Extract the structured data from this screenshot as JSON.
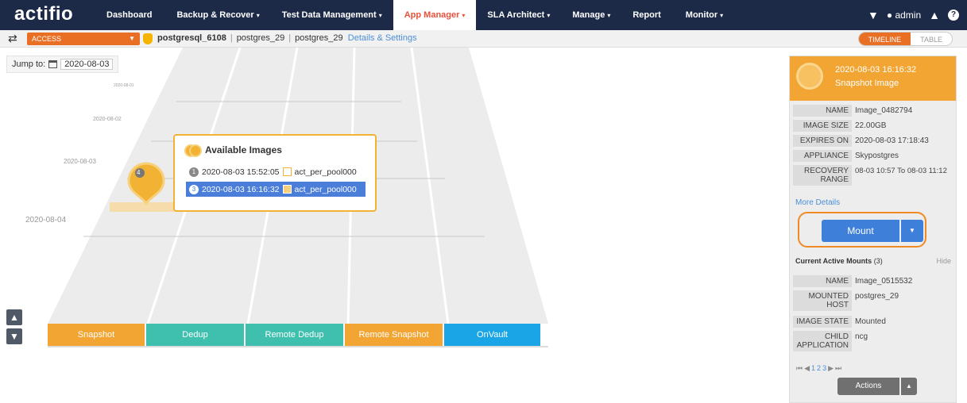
{
  "app": {
    "logo": "actifio"
  },
  "nav": [
    {
      "label": "Dashboard",
      "caret": ""
    },
    {
      "label": "Backup & Recover",
      "caret": "▾"
    },
    {
      "label": "Test Data Management",
      "caret": "▾"
    },
    {
      "label": "App Manager",
      "caret": "▾"
    },
    {
      "label": "SLA Architect",
      "caret": "▾"
    },
    {
      "label": "Manage",
      "caret": "▾"
    },
    {
      "label": "Report",
      "caret": ""
    },
    {
      "label": "Monitor",
      "caret": "▾"
    }
  ],
  "nav_active": "App Manager",
  "user": {
    "name": "admin"
  },
  "subbar": {
    "access_label": "ACCESS",
    "app_name": "postgresql_6108",
    "crumb_2": "postgres_29",
    "crumb_3": "postgres_29",
    "details_link": "Details & Settings",
    "view_timeline": "TIMELINE",
    "view_table": "TABLE"
  },
  "timeline": {
    "jump_label": "Jump to:",
    "jump_date": "2020-08-03",
    "date_labels": [
      "2020-08-01",
      "2020-08-02",
      "2020-08-03",
      "2020-08-04"
    ],
    "marker_count": "4",
    "lanes": [
      {
        "label": "Snapshot",
        "color": "#f2a533"
      },
      {
        "label": "Dedup",
        "color": "#3fbfae"
      },
      {
        "label": "Remote Dedup",
        "color": "#3fbfae"
      },
      {
        "label": "Remote Snapshot",
        "color": "#f2a533"
      },
      {
        "label": "OnVault",
        "color": "#1aa6e6"
      }
    ]
  },
  "popup": {
    "title": "Available Images",
    "rows": [
      {
        "num": "1",
        "time": "2020-08-03 15:52:05",
        "pool": "act_per_pool000",
        "selected": false
      },
      {
        "num": "3",
        "time": "2020-08-03 16:16:32",
        "pool": "act_per_pool000",
        "selected": true
      }
    ]
  },
  "sidebar": {
    "header_time": "2020-08-03  16:16:32",
    "header_type": "Snapshot Image",
    "details": [
      {
        "key": "NAME",
        "value": "Image_0482794"
      },
      {
        "key": "IMAGE SIZE",
        "value": "22.00GB"
      },
      {
        "key": "EXPIRES ON",
        "value": "2020-08-03 17:18:43"
      },
      {
        "key": "APPLIANCE",
        "value": "Skypostgres"
      },
      {
        "key": "RECOVERY RANGE",
        "value": "08-03 10:57 To 08-03 11:12"
      }
    ],
    "more_details": "More Details",
    "mount_label": "Mount",
    "current_mounts_label": "Current Active Mounts",
    "current_mounts_count": "(3)",
    "hide_label": "Hide",
    "mounts": [
      {
        "key": "NAME",
        "value": "Image_0515532"
      },
      {
        "key": "MOUNTED HOST",
        "value": "postgres_29"
      },
      {
        "key": "IMAGE STATE",
        "value": "Mounted"
      },
      {
        "key": "CHILD APPLICATION",
        "value": "ncg"
      }
    ],
    "pager_first": "⏮",
    "pager_prev": "◀",
    "pages": [
      "1",
      "2",
      "3"
    ],
    "pager_next": "▶",
    "pager_last": "⏭",
    "actions_label": "Actions"
  }
}
